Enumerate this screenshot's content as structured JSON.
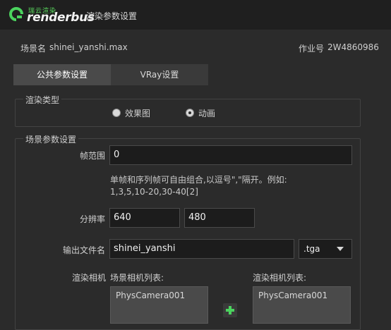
{
  "window": {
    "brand_cn": "瑞云渲染",
    "brand_en": "renderbus",
    "title": "渲染参数设置"
  },
  "meta": {
    "scene_label": "场景名",
    "scene_value": "shinei_yanshi.max",
    "job_label": "作业号",
    "job_value": "2W4860986"
  },
  "tabs": [
    {
      "label": "公共参数设置",
      "active": true
    },
    {
      "label": "VRay设置",
      "active": false
    }
  ],
  "render_type": {
    "title": "渲染类型",
    "options": [
      {
        "label": "效果图",
        "checked": false
      },
      {
        "label": "动画",
        "checked": true
      }
    ]
  },
  "scene_params": {
    "title": "场景参数设置",
    "frame_range_label": "帧范围",
    "frame_range_value": "0",
    "hint_line1": "单帧和序列帧可自由组合,以逗号\",\"隔开。例如:",
    "hint_line2": "1,3,5,10-20,30-40[2]",
    "resolution_label": "分辨率",
    "width_value": "640",
    "height_value": "480",
    "output_label": "输出文件名",
    "output_value": "shinei_yanshi",
    "format_value": ".tga",
    "camera_label": "渲染相机",
    "scene_cameras_label": "场景相机列表:",
    "render_cameras_label": "渲染相机列表:",
    "scene_cameras": [
      "PhysCamera001"
    ],
    "render_cameras": [
      "PhysCamera001"
    ]
  },
  "colors": {
    "accent": "#4bd35e",
    "background": "#2b2b2b",
    "titlebar": "#1f1f1f"
  }
}
